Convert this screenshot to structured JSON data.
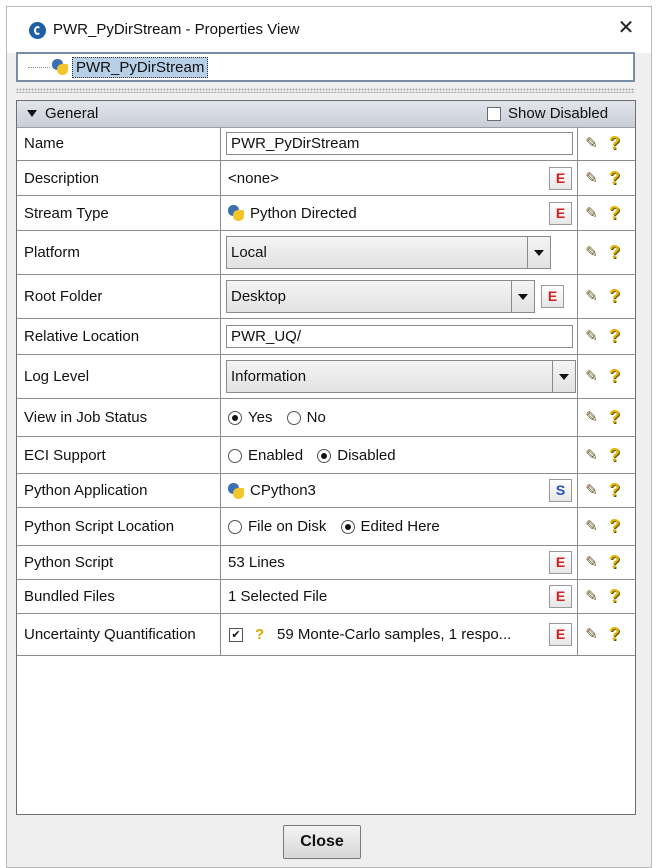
{
  "window": {
    "title": "PWR_PyDirStream - Properties View",
    "close_glyph": "✕"
  },
  "tree": {
    "node_label": "PWR_PyDirStream",
    "node_icon": "python-icon"
  },
  "panel": {
    "section_label": "General",
    "show_disabled_label": "Show Disabled",
    "show_disabled_checked": false
  },
  "properties": {
    "name": {
      "label": "Name",
      "value": "PWR_PyDirStream"
    },
    "description": {
      "label": "Description",
      "value": "<none>"
    },
    "stream_type": {
      "label": "Stream Type",
      "value": "Python Directed"
    },
    "platform": {
      "label": "Platform",
      "value": "Local"
    },
    "root_folder": {
      "label": "Root Folder",
      "value": "Desktop"
    },
    "relative_location": {
      "label": "Relative Location",
      "value": "PWR_UQ/"
    },
    "log_level": {
      "label": "Log Level",
      "value": "Information"
    },
    "view_in_job_status": {
      "label": "View in Job Status",
      "option_yes": "Yes",
      "option_no": "No",
      "selected": "Yes"
    },
    "eci_support": {
      "label": "ECI Support",
      "option_enabled": "Enabled",
      "option_disabled": "Disabled",
      "selected": "Disabled"
    },
    "python_application": {
      "label": "Python Application",
      "value": "CPython3"
    },
    "python_script_location": {
      "label": "Python Script Location",
      "option_file": "File on Disk",
      "option_edited": "Edited Here",
      "selected": "Edited Here"
    },
    "python_script": {
      "label": "Python Script",
      "value": "53 Lines"
    },
    "bundled_files": {
      "label": "Bundled Files",
      "value": "1 Selected File"
    },
    "uncertainty_quantification": {
      "label": "Uncertainty Quantification",
      "checked": true,
      "value": "59 Monte-Carlo samples, 1 respo..."
    }
  },
  "buttons": {
    "edit_glyph": "E",
    "script_glyph": "S",
    "help_glyph": "?",
    "doc_glyph": "✎",
    "close_label": "Close"
  },
  "colors": {
    "accent": "#1e5fa7",
    "edit_red": "#d42020",
    "help_yellow": "#e0b400"
  }
}
